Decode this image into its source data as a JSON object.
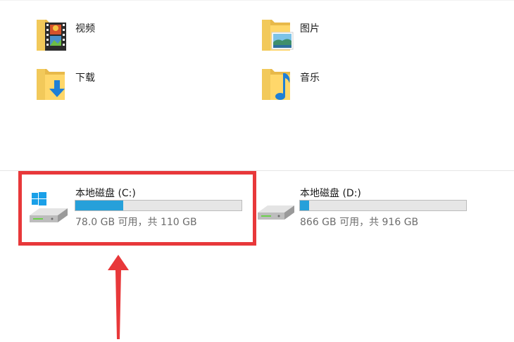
{
  "folders": [
    {
      "label": "视频",
      "icon": "video-folder-icon"
    },
    {
      "label": "图片",
      "icon": "pictures-folder-icon"
    },
    {
      "label": "下载",
      "icon": "downloads-folder-icon"
    },
    {
      "label": "音乐",
      "icon": "music-folder-icon"
    }
  ],
  "drives": [
    {
      "name": "本地磁盘 (C:)",
      "space": "78.0 GB 可用，共 110 GB",
      "used_fraction": 0.29,
      "icon": "windows-system-drive-icon"
    },
    {
      "name": "本地磁盘 (D:)",
      "space": "866 GB 可用，共 916 GB",
      "used_fraction": 0.055,
      "icon": "hard-drive-icon"
    }
  ],
  "colors": {
    "usage_bar_fill": "#26a0da",
    "usage_bar_track": "#e6e6e6",
    "annotation_red": "#e8383a"
  }
}
